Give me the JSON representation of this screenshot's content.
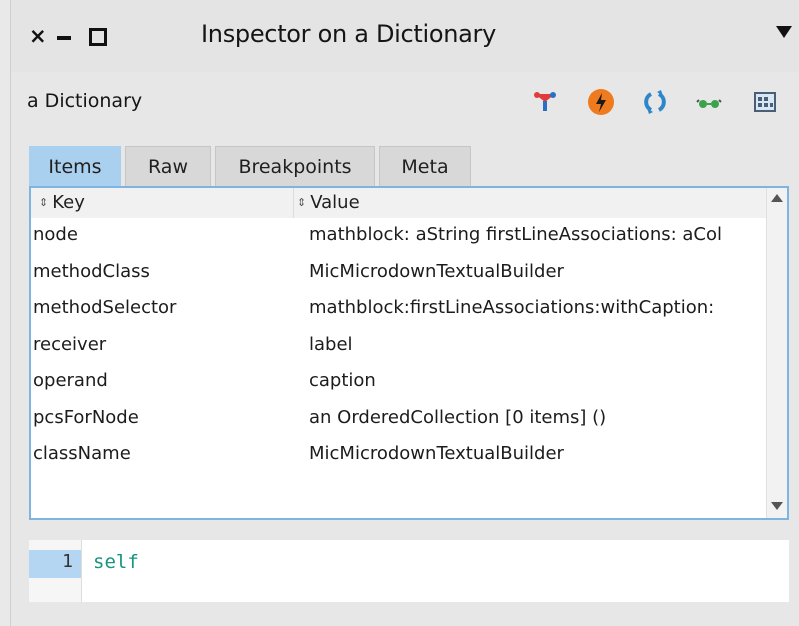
{
  "window": {
    "title": "Inspector on a Dictionary",
    "controls": {
      "close": "×"
    }
  },
  "header": {
    "object_label": "a Dictionary",
    "toolbar_icons": [
      "browse-icon",
      "debug-lightning-icon",
      "refresh-icon",
      "glasses-icon",
      "grid-panel-icon"
    ]
  },
  "tabs": [
    {
      "label": "Items",
      "active": true
    },
    {
      "label": "Raw",
      "active": false
    },
    {
      "label": "Breakpoints",
      "active": false
    },
    {
      "label": "Meta",
      "active": false
    }
  ],
  "table": {
    "columns": [
      {
        "label": "Key",
        "sort_icon": "⇕"
      },
      {
        "label": "Value",
        "sort_icon": "⇕"
      }
    ],
    "rows": [
      {
        "key": "node",
        "value": "mathblock: aString firstLineAssociations: aCol"
      },
      {
        "key": "methodClass",
        "value": "MicMicrodownTextualBuilder"
      },
      {
        "key": "methodSelector",
        "value": "mathblock:firstLineAssociations:withCaption:"
      },
      {
        "key": "receiver",
        "value": "label"
      },
      {
        "key": "operand",
        "value": "caption"
      },
      {
        "key": "pcsForNode",
        "value": "an OrderedCollection [0 items] ()"
      },
      {
        "key": "className",
        "value": "MicMicrodownTextualBuilder"
      }
    ]
  },
  "editor": {
    "line_number": "1",
    "code": "self"
  },
  "colors": {
    "active_tab": "#a9d0ef",
    "panel_border": "#7fb4e0",
    "code_text": "#16957f",
    "gutter_highlight": "#b4d6f3"
  }
}
